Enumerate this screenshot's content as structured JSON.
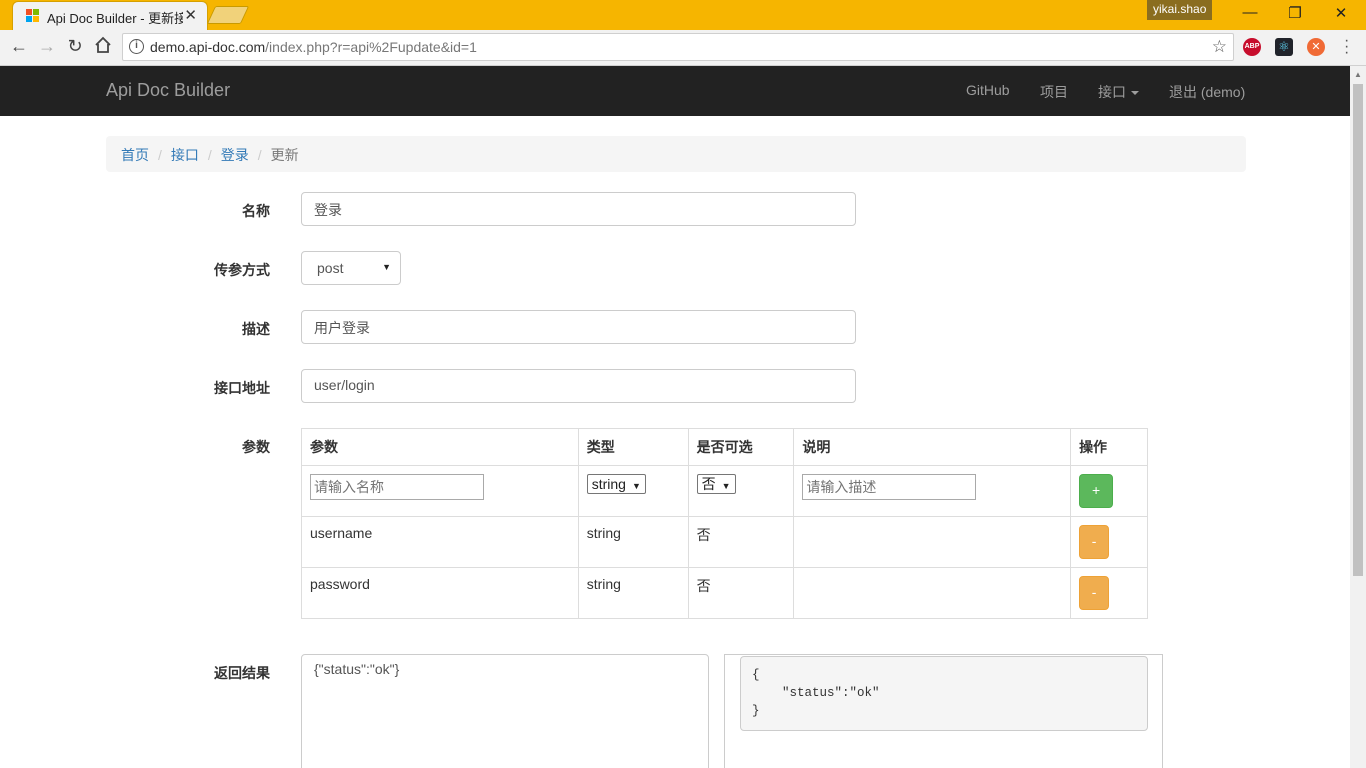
{
  "browser": {
    "tab_title": "Api Doc Builder - 更新接",
    "profile_name": "yikai.shao",
    "url_host": "demo.api-doc.com",
    "url_path": "/index.php?r=api%2Fupdate&id=1",
    "extensions": [
      {
        "name": "adblock-plus-icon",
        "label": "ABP",
        "color": "#c70d2c"
      },
      {
        "name": "react-devtools-icon",
        "label": "⚛",
        "color": "#20232a"
      },
      {
        "name": "orange-extension-icon",
        "label": "✕",
        "color": "#f06a35"
      }
    ]
  },
  "navbar": {
    "brand": "Api Doc Builder",
    "github": "GitHub",
    "projects": "项目",
    "apis": "接口",
    "logout": "退出 (demo)"
  },
  "breadcrumb": {
    "home": "首页",
    "apis": "接口",
    "current_api": "登录",
    "active": "更新"
  },
  "form": {
    "name_label": "名称",
    "name_value": "登录",
    "method_label": "传参方式",
    "method_value": "post",
    "desc_label": "描述",
    "desc_value": "用户登录",
    "url_label": "接口地址",
    "url_value": "user/login",
    "params_label": "参数",
    "result_label": "返回结果",
    "result_value": "{\"status\":\"ok\"}",
    "result_preview": "{\n    \"status\":\"ok\"\n}"
  },
  "params_table": {
    "headers": [
      "参数",
      "类型",
      "是否可选",
      "说明",
      "操作"
    ],
    "new_row": {
      "name_placeholder": "请输入名称",
      "type_value": "string",
      "optional_value": "否",
      "desc_placeholder": "请输入描述",
      "add_label": "+"
    },
    "rows": [
      {
        "name": "username",
        "type": "string",
        "optional": "否",
        "desc": "",
        "remove_label": "-"
      },
      {
        "name": "password",
        "type": "string",
        "optional": "否",
        "desc": "",
        "remove_label": "-"
      }
    ]
  }
}
